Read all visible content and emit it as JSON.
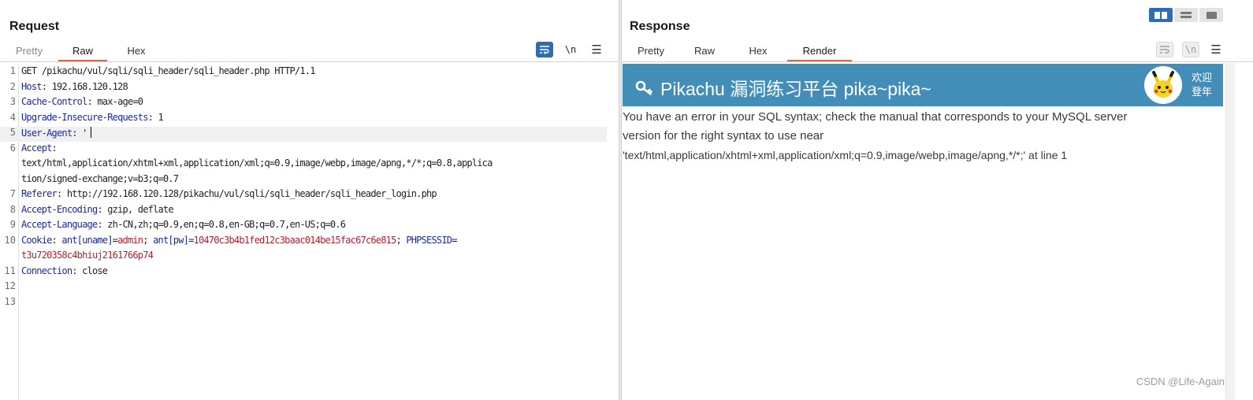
{
  "request": {
    "title": "Request",
    "tabs": [
      "Pretty",
      "Raw",
      "Hex"
    ],
    "active_tab": "Raw",
    "tools": {
      "wrap_icon": "wrap-lines-icon",
      "newline_label": "\\n",
      "menu_icon": "hamburger-menu-icon"
    },
    "lines": [
      {
        "n": "1",
        "text": "GET /pikachu/vul/sqli/sqli_header/sqli_header.php HTTP/1.1"
      },
      {
        "n": "2",
        "key": "Host",
        "val": " 192.168.120.128"
      },
      {
        "n": "3",
        "key": "Cache-Control",
        "val": " max-age=0"
      },
      {
        "n": "4",
        "key": "Upgrade-Insecure-Requests",
        "val": " 1"
      },
      {
        "n": "5",
        "key": "User-Agent",
        "val": " '"
      },
      {
        "n": "6",
        "key": "Accept",
        "val": ""
      },
      {
        "n": "",
        "text": "text/html,application/xhtml+xml,application/xml;q=0.9,image/webp,image/apng,*/*;q=0.8,applica"
      },
      {
        "n": "",
        "text": "tion/signed-exchange;v=b3;q=0.7"
      },
      {
        "n": "7",
        "key": "Referer",
        "val": " http://192.168.120.128/pikachu/vul/sqli/sqli_header/sqli_header_login.php"
      },
      {
        "n": "8",
        "key": "Accept-Encoding",
        "val": " gzip, deflate"
      },
      {
        "n": "9",
        "key": "Accept-Language",
        "val": " zh-CN,zh;q=0.9,en;q=0.8,en-GB;q=0.7,en-US;q=0.6"
      },
      {
        "n": "10",
        "cookie_key": "Cookie",
        "c1k": " ant[uname]",
        "c1v": "admin",
        "c2k": " ant[pw]",
        "c2v": "10470c3b4b1fed12c3baac014be15fac67c6e815",
        "c3k": " PHPSESSID"
      },
      {
        "n": "",
        "cv": "t3u720358c4bhiuj2161766p74"
      },
      {
        "n": "11",
        "key": "Connection",
        "val": " close"
      },
      {
        "n": "12",
        "text": ""
      },
      {
        "n": "13",
        "text": ""
      }
    ]
  },
  "response": {
    "title": "Response",
    "tabs": [
      "Pretty",
      "Raw",
      "Hex",
      "Render"
    ],
    "active_tab": "Render",
    "tools": {
      "newline_label": "\\n"
    },
    "render": {
      "banner_title": "Pikachu 漏洞练习平台 pika~pika~",
      "welcome_line1": "欢迎",
      "welcome_line2": "登年",
      "error_line1": "You have an error in your SQL syntax; check the manual that corresponds to your MySQL server",
      "error_line2": "version for the right syntax to use near",
      "error_line3": "'text/html,application/xhtml+xml,application/xml;q=0.9,image/webp,image/apng,*/*;' at line 1"
    }
  },
  "layout_toggle": [
    "side-by-side-icon",
    "top-bottom-icon",
    "single-pane-icon"
  ],
  "colors": {
    "accent": "#2e6db4",
    "tab_underline": "#e8653a",
    "banner": "#438eb9",
    "header_key": "#1a2a9c",
    "cookie_val": "#b5202e"
  },
  "watermark": "CSDN @Life-Again"
}
